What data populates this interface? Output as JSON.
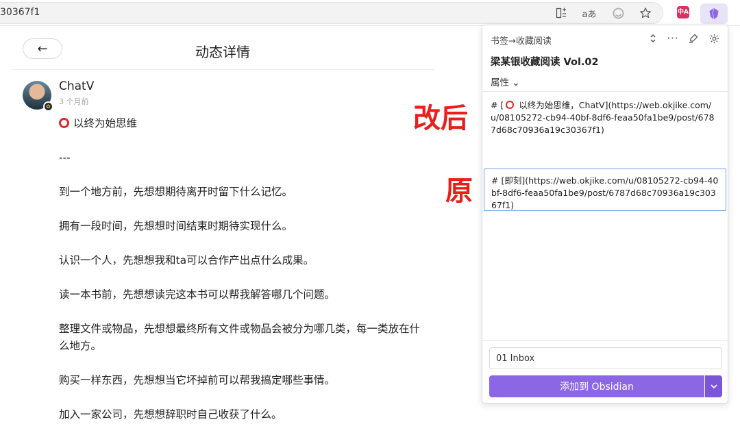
{
  "browser": {
    "url_fragment": "30367f1",
    "translate_label": "aあ",
    "ext_red_label": "中A"
  },
  "post_page": {
    "back_label": "←",
    "title": "动态详情",
    "author": "ChatV",
    "time": "3 个月前",
    "headline": "以终为始思维",
    "separator": "---",
    "paragraphs": [
      "到一个地方前，先想想期待离开时留下什么记忆。",
      "拥有一段时间，先想想时间结束时期待实现什么。",
      "认识一个人，先想想我和ta可以合作产出点什么成果。",
      "读一本书前，先想想读完这本书可以帮我解答哪几个问题。",
      "整理文件或物品，先想想最终所有文件或物品会被分为哪几类，每一类放在什么地方。",
      "购买一样东西，先想想当它坏掉前可以帮我搞定哪些事情。",
      "加入一家公司，先想想辞职时自己收获了什么。"
    ]
  },
  "annotations": {
    "after": "改后",
    "original": "原"
  },
  "panel": {
    "header": "书签→收藏阅读",
    "note_title": "梁某银收藏阅读 Vol.02",
    "properties_label": "属性",
    "content_after_prefix": "# [",
    "content_after_rest": " 以终为始思维，ChatV](https://web.okjike.com/u/08105272-cb94-40bf-8df6-feaa50fa1be9/post/6787d68c70936a19c30367f1)",
    "content_original": "# [即刻](https://web.okjike.com/u/08105272-cb94-40bf-8df6-feaa50fa1be9/post/6787d68c70936a19c30367f1)",
    "vault_folder": "01 Inbox",
    "add_button": "添加到 Obsidian"
  },
  "colors": {
    "accent": "#8b67e6",
    "annotation_red": "#e8201b",
    "focus_border": "#6ea0e8"
  }
}
